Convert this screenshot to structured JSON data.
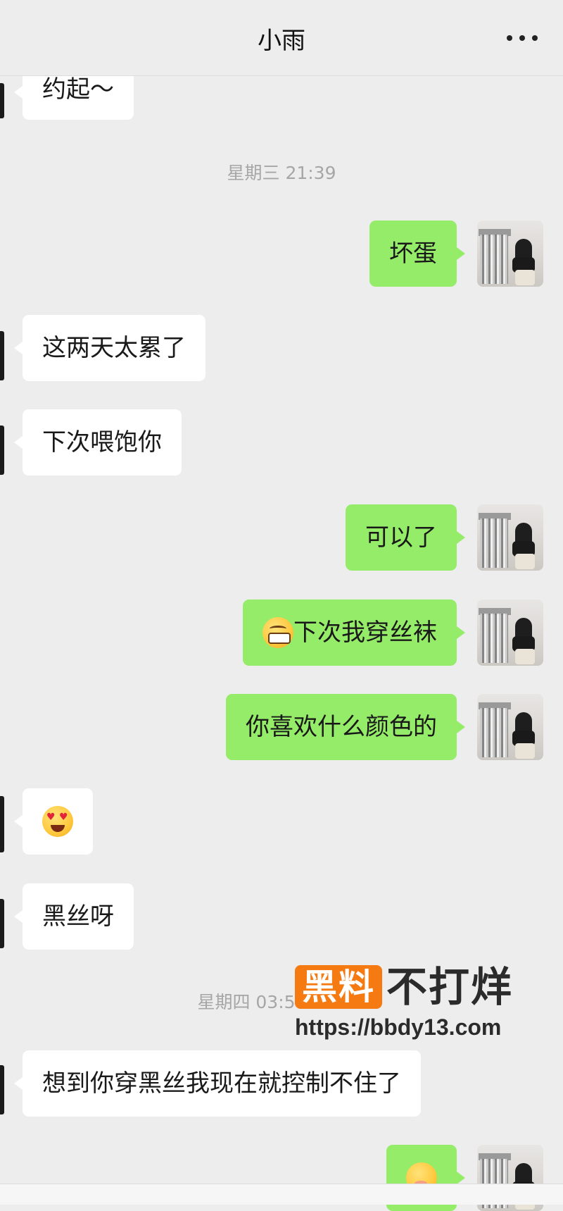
{
  "header": {
    "title": "小雨",
    "more_icon": "more-dots-icon"
  },
  "timestamps": [
    "星期三 21:39",
    "星期四 03:5"
  ],
  "messages": [
    {
      "side": "in",
      "text": "约起～"
    },
    {
      "side": "out",
      "text": "坏蛋"
    },
    {
      "side": "in",
      "text": "这两天太累了"
    },
    {
      "side": "in",
      "text": "下次喂饱你"
    },
    {
      "side": "out",
      "text": "可以了"
    },
    {
      "side": "out",
      "emoji": "grin-emoji",
      "text": "下次我穿丝袜"
    },
    {
      "side": "out",
      "text": "你喜欢什么颜色的"
    },
    {
      "side": "in",
      "emoji": "heart-eyes-emoji",
      "text": ""
    },
    {
      "side": "in",
      "text": "黑丝呀"
    },
    {
      "side": "in",
      "text": "想到你穿黑丝我现在就控制不住了"
    },
    {
      "side": "out",
      "emoji": "blush-emoji",
      "text": ""
    }
  ],
  "watermark": {
    "badge": "黑料",
    "text": "不打烊",
    "url": "https://bbdy13.com"
  },
  "colors": {
    "background": "#ededed",
    "incoming": "#ffffff",
    "outgoing": "#95ec69",
    "watermark": "#f57a12"
  }
}
